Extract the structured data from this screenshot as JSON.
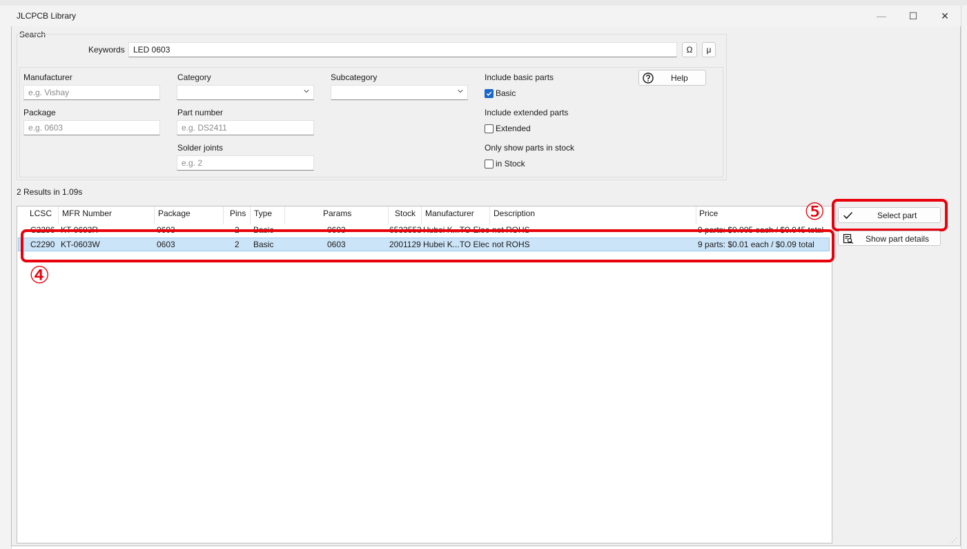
{
  "window": {
    "title": "JLCPCB Library",
    "minimize_glyph": "—",
    "maximize_glyph": "☐",
    "close_glyph": "✕"
  },
  "search": {
    "group_label": "Search",
    "keywords_label": "Keywords",
    "keywords_value": "LED 0603",
    "omega_button": "Ω",
    "mu_button": "μ"
  },
  "filters": {
    "manufacturer_label": "Manufacturer",
    "manufacturer_placeholder": "e.g. Vishay",
    "package_label": "Package",
    "package_placeholder": "e.g. 0603",
    "category_label": "Category",
    "category_value": "",
    "part_number_label": "Part number",
    "part_number_placeholder": "e.g. DS2411",
    "solder_joints_label": "Solder joints",
    "solder_joints_placeholder": "e.g. 2",
    "subcategory_label": "Subcategory",
    "subcategory_value": "",
    "include_basic_label": "Include basic parts",
    "basic_checkbox_label": "Basic",
    "basic_checked": true,
    "include_extended_label": "Include extended parts",
    "extended_checkbox_label": "Extended",
    "extended_checked": false,
    "in_stock_group_label": "Only show parts in stock",
    "in_stock_checkbox_label": "in Stock",
    "in_stock_checked": false,
    "help_button": "Help"
  },
  "results": {
    "summary": "2 Results in 1.09s",
    "columns": [
      "LCSC",
      "MFR Number",
      "Package",
      "Pins",
      "Type",
      "Params",
      "Stock",
      "Manufacturer",
      "Description",
      "Price"
    ],
    "rows": [
      {
        "lcsc": "C2286",
        "mfr": "KT-0603R",
        "package": "0603",
        "pins": "2",
        "type": "Basic",
        "params": "0603",
        "stock": "6533553",
        "manufacturer": "Hubei K...TO Elec",
        "description": "not ROHS",
        "price": "9 parts: $0.005 each / $0.045 total"
      },
      {
        "lcsc": "C2290",
        "mfr": "KT-0603W",
        "package": "0603",
        "pins": "2",
        "type": "Basic",
        "params": "0603",
        "stock": "2001129",
        "manufacturer": "Hubei K...TO Elec",
        "description": "not ROHS",
        "price": "9 parts: $0.01 each / $0.09 total"
      }
    ]
  },
  "actions": {
    "select_part": "Select part",
    "show_part_details": "Show part details"
  },
  "annotations": {
    "step4": "④",
    "step5": "⑤"
  },
  "colors": {
    "highlight": "#e8000b",
    "selection": "#cce4f7",
    "checkbox_checked": "#1a66c9"
  }
}
